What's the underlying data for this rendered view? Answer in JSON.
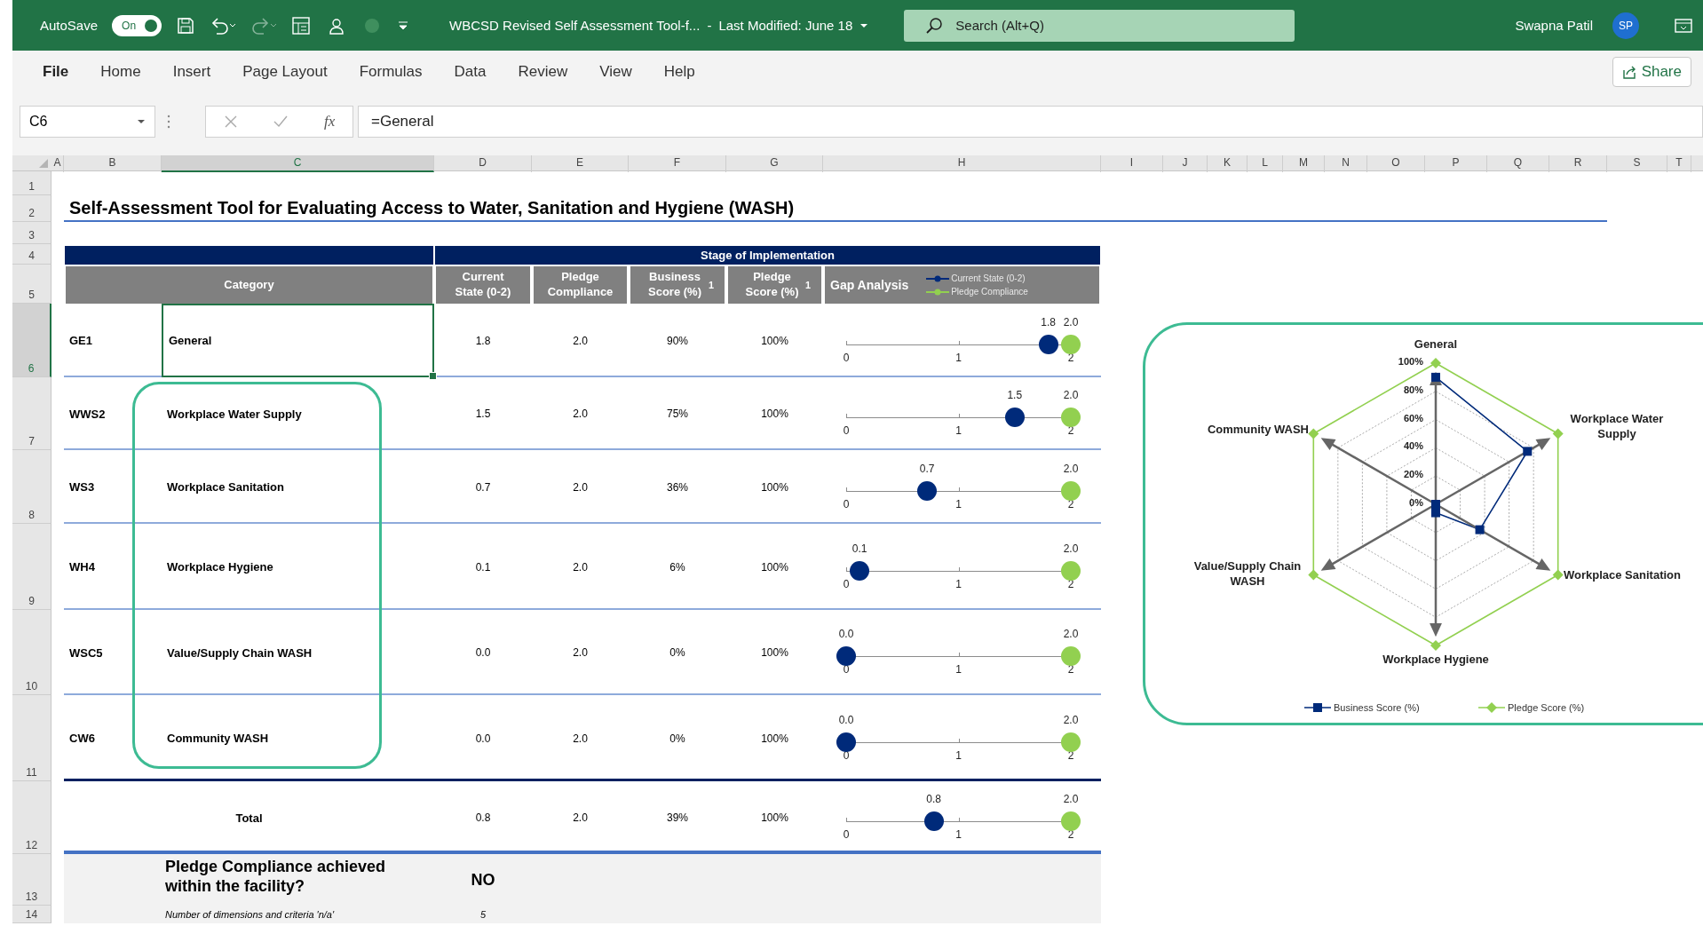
{
  "title_bar": {
    "autosave_label": "AutoSave",
    "autosave": {
      "on": true,
      "label": "On"
    },
    "document_title": "WBCSD Revised Self Assessment Tool-f...",
    "separator": "-",
    "modified": "Last Modified: June 18",
    "search_placeholder": "Search (Alt+Q)",
    "user_name": "Swapna Patil",
    "user_initials": "SP"
  },
  "ribbon": {
    "file_tab": "File",
    "tabs": [
      "Home",
      "Insert",
      "Page Layout",
      "Formulas",
      "Data",
      "Review",
      "View",
      "Help"
    ],
    "share": "Share"
  },
  "formula_bar": {
    "name_box": "C6",
    "function_label": "fx",
    "formula": "=General"
  },
  "columns": [
    {
      "label": "A",
      "selected": false
    },
    {
      "label": "B",
      "selected": false
    },
    {
      "label": "C",
      "selected": true
    },
    {
      "label": "D",
      "selected": false
    },
    {
      "label": "E",
      "selected": false
    },
    {
      "label": "F",
      "selected": false
    },
    {
      "label": "G",
      "selected": false
    },
    {
      "label": "H",
      "selected": false
    },
    {
      "label": "I",
      "selected": false
    },
    {
      "label": "J",
      "selected": false
    },
    {
      "label": "K",
      "selected": false
    },
    {
      "label": "L",
      "selected": false
    },
    {
      "label": "M",
      "selected": false
    },
    {
      "label": "N",
      "selected": false
    },
    {
      "label": "O",
      "selected": false
    },
    {
      "label": "P",
      "selected": false
    },
    {
      "label": "Q",
      "selected": false
    },
    {
      "label": "R",
      "selected": false
    },
    {
      "label": "S",
      "selected": false
    },
    {
      "label": "T",
      "selected": false
    }
  ],
  "rows": [
    {
      "label": "1",
      "selected": false
    },
    {
      "label": "2",
      "selected": false
    },
    {
      "label": "3",
      "selected": false
    },
    {
      "label": "4",
      "selected": false
    },
    {
      "label": "5",
      "selected": false
    },
    {
      "label": "6",
      "selected": true
    },
    {
      "label": "7",
      "selected": false
    },
    {
      "label": "8",
      "selected": false
    },
    {
      "label": "9",
      "selected": false
    },
    {
      "label": "10",
      "selected": false
    },
    {
      "label": "11",
      "selected": false
    },
    {
      "label": "12",
      "selected": false
    },
    {
      "label": "13",
      "selected": false
    },
    {
      "label": "14",
      "selected": false
    }
  ],
  "sheet": {
    "heading": "Self-Assessment Tool for Evaluating Access to Water, Sanitation and Hygiene (WASH)",
    "stage_header": "Stage of Implementation",
    "headers": {
      "category": "Category",
      "current_state": "Current State (0-2)",
      "pledge_compliance": "Pledge Compliance",
      "business_score": "Business Score (%)$^{1}$",
      "pledge_score": "Pledge Score (%)$^{1}$",
      "gap_analysis": "Gap Analysis"
    },
    "legend": [
      {
        "label": "Current State (0-2)",
        "color": "#002a7a"
      },
      {
        "label": "Pledge Compliance",
        "color": "#92d050"
      }
    ],
    "items": [
      {
        "code": "GE1",
        "category": "General",
        "selected": true,
        "current_state": "1.8",
        "pledge_compliance": "2.0",
        "business_score": "90%",
        "pledge_score": "100%",
        "gap": {
          "current": {
            "label": "1.8",
            "level": 0.9
          },
          "pledge": {
            "label": "2.0",
            "level": 1
          },
          "ticks": [
            "0",
            "1",
            "2"
          ]
        }
      },
      {
        "code": "WWS2",
        "category": "Workplace Water Supply",
        "selected": false,
        "current_state": "1.5",
        "pledge_compliance": "2.0",
        "business_score": "75%",
        "pledge_score": "100%",
        "gap": {
          "current": {
            "label": "1.5",
            "level": 0.75
          },
          "pledge": {
            "label": "2.0",
            "level": 1
          },
          "ticks": [
            "0",
            "1",
            "2"
          ]
        }
      },
      {
        "code": "WS3",
        "category": "Workplace Sanitation",
        "selected": false,
        "current_state": "0.7",
        "pledge_compliance": "2.0",
        "business_score": "36%",
        "pledge_score": "100%",
        "gap": {
          "current": {
            "label": "0.7",
            "level": 0.36
          },
          "pledge": {
            "label": "2.0",
            "level": 1
          },
          "ticks": [
            "0",
            "1",
            "2"
          ]
        }
      },
      {
        "code": "WH4",
        "category": "Workplace Hygiene",
        "selected": false,
        "current_state": "0.1",
        "pledge_compliance": "2.0",
        "business_score": "6%",
        "pledge_score": "100%",
        "gap": {
          "current": {
            "label": "0.1",
            "level": 0.06
          },
          "pledge": {
            "label": "2.0",
            "level": 1
          },
          "ticks": [
            "0",
            "1",
            "2"
          ]
        }
      },
      {
        "code": "WSC5",
        "category": "Value/Supply Chain WASH",
        "selected": false,
        "current_state": "0.0",
        "pledge_compliance": "2.0",
        "business_score": "0%",
        "pledge_score": "100%",
        "gap": {
          "current": {
            "label": "0.0",
            "level": 0
          },
          "pledge": {
            "label": "2.0",
            "level": 1
          },
          "ticks": [
            "0",
            "1",
            "2"
          ]
        }
      },
      {
        "code": "CW6",
        "category": "Community WASH",
        "selected": false,
        "current_state": "0.0",
        "pledge_compliance": "2.0",
        "business_score": "0%",
        "pledge_score": "100%",
        "gap": {
          "current": {
            "label": "0.0",
            "level": 0
          },
          "pledge": {
            "label": "2.0",
            "level": 1
          },
          "ticks": [
            "0",
            "1",
            "2"
          ]
        }
      }
    ],
    "total": {
      "label": "Total",
      "current_state": "0.8",
      "pledge_compliance": "2.0",
      "business_score": "39%",
      "pledge_score": "100%",
      "gap": {
        "current": {
          "label": "0.8",
          "level": 0.39
        },
        "pledge": {
          "label": "2.0",
          "level": 1
        },
        "ticks": [
          "0",
          "1",
          "2"
        ]
      }
    },
    "compliance": {
      "question": "Pledge Compliance achieved within the facility?",
      "answer": "NO",
      "note": "Number of dimensions and criteria 'n/a'",
      "note_value": "5"
    },
    "chart": {
      "categories": [
        {
          "label": "General",
          "kind": "top"
        },
        {
          "label": "Community WASH",
          "kind": "upper-left"
        },
        {
          "label": "Workplace Water Supply",
          "kind": "upper-right"
        },
        {
          "label": "Value/Supply Chain WASH",
          "kind": "lower-left"
        },
        {
          "label": "Workplace Sanitation",
          "kind": "lower-right"
        },
        {
          "label": "Workplace Hygiene",
          "kind": "bottom"
        }
      ],
      "axis_labels": [
        "100%",
        "80%",
        "60%",
        "40%",
        "20%",
        "0%"
      ],
      "series": [
        {
          "name": "Business Score (%)",
          "color": "#002a7a",
          "kind": "square"
        },
        {
          "name": "Pledge Score (%)",
          "color": "#92d050",
          "kind": "diamond"
        }
      ]
    }
  }
}
